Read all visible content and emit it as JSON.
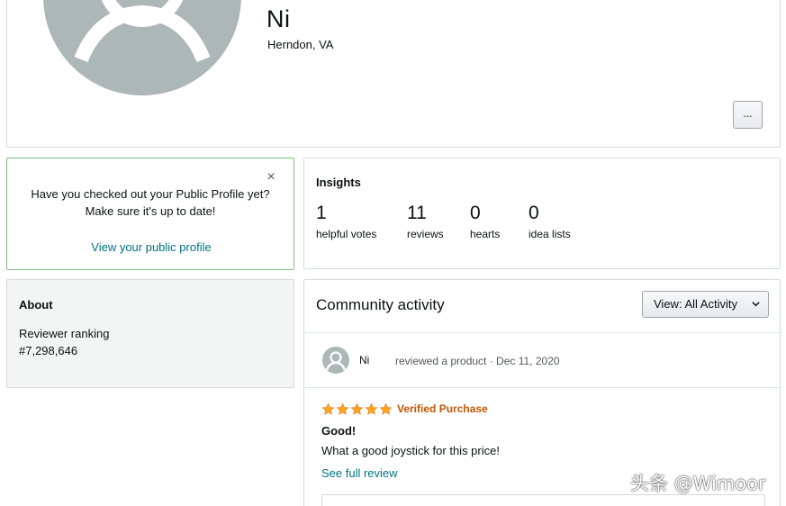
{
  "profile": {
    "name": "Ni",
    "location": "Herndon, VA",
    "more_label": "..."
  },
  "reminder": {
    "line1": "Have you checked out your Public Profile yet?",
    "line2": "Make sure it's up to date!",
    "link": "View your public profile",
    "close": "×"
  },
  "insights": {
    "title": "Insights",
    "stats": [
      {
        "value": "1",
        "label": "helpful votes"
      },
      {
        "value": "11",
        "label": "reviews"
      },
      {
        "value": "0",
        "label": "hearts"
      },
      {
        "value": "0",
        "label": "idea lists"
      }
    ]
  },
  "about": {
    "title": "About",
    "ranking_label": "Reviewer ranking",
    "ranking_value": "#7,298,646"
  },
  "activity": {
    "title": "Community activity",
    "view_label": "View:  All Activity",
    "item": {
      "user": "Ni",
      "meta": "reviewed a product · Dec 11, 2020",
      "rating": 5,
      "badge": "Verified Purchase",
      "review_title": "Good!",
      "review_body": "What a good joystick for this price!",
      "see_full": "See full review"
    }
  },
  "watermark": "头条 @Wimoor",
  "colors": {
    "link": "#007185",
    "verified": "#c45500",
    "star": "#ffa41c",
    "reminder_border": "#7fc07b",
    "avatar": "#aeb7b8"
  }
}
